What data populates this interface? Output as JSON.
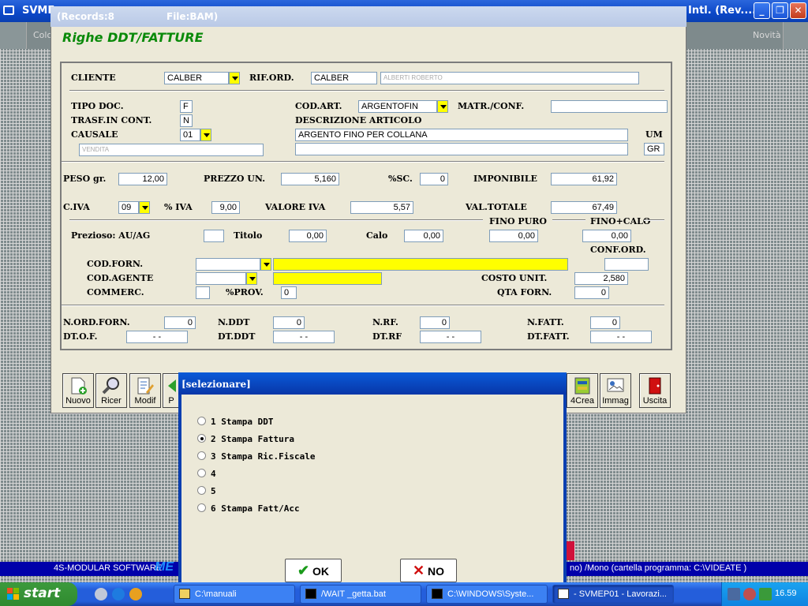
{
  "app": {
    "title": "SVME",
    "title_right": "Intl. (Rev....",
    "toolbar_left": "Colo",
    "toolbar_right": "Novità"
  },
  "window": {
    "records": "(Records:8",
    "file": "File:BAM)",
    "form_title": "Righe DDT/FATTURE"
  },
  "form": {
    "cliente_label": "CLIENTE",
    "cliente": "CALBER",
    "rif_ord_label": "RIF.ORD.",
    "rif_ord": "CALBER",
    "cliente_name": "ALBERTI ROBERTO",
    "tipo_doc_label": "TIPO DOC.",
    "tipo_doc": "F",
    "trasf_label": "TRASF.IN CONT.",
    "trasf": "N",
    "causale_label": "CAUSALE",
    "causale": "01",
    "causale_desc": "VENDITA",
    "cod_art_label": "COD.ART.",
    "cod_art": "ARGENTOFIN",
    "matr_label": "MATR./CONF.",
    "matr": "",
    "descr_label": "DESCRIZIONE ARTICOLO",
    "descr": "ARGENTO FINO PER COLLANA",
    "descr2": "",
    "um_label": "UM",
    "um": "GR",
    "peso_label": "PESO gr.",
    "peso": "12,00",
    "prezzo_label": "PREZZO UN.",
    "prezzo": "5,160",
    "sc_label": "%SC.",
    "sc": "0",
    "imponibile_label": "IMPONIBILE",
    "imponibile": "61,92",
    "civa_label": "C.IVA",
    "civa": "09",
    "piva_label": "% IVA",
    "piva": "9,00",
    "valore_iva_label": "VALORE IVA",
    "valore_iva": "5,57",
    "val_totale_label": "VAL.TOTALE",
    "val_totale": "67,49",
    "fino_puro_label": "FINO PURO",
    "fino_calo_label": "FINO+CALO",
    "prezioso_label": "Prezioso: AU/AG",
    "prezioso": "",
    "titolo_label": "Titolo",
    "titolo": "0,00",
    "calo_label": "Calo",
    "calo": "0,00",
    "fino_puro": "0,00",
    "fino_calo": "0,00",
    "conf_ord_label": "CONF.ORD.",
    "cod_forn_label": "COD.FORN.",
    "cod_forn": "",
    "conf_ord": "",
    "cod_agente_label": "COD.AGENTE",
    "cod_agente": "",
    "costo_unit_label": "COSTO UNIT.",
    "costo_unit": "2,580",
    "commerc_label": "COMMERC.",
    "commerc": "",
    "prov_label": "%PROV.",
    "prov": "0",
    "qta_forn_label": "QTA FORN.",
    "qta_forn": "0",
    "n_ord_forn_label": "N.ORD.FORN.",
    "n_ord_forn": "0",
    "n_ddt_label": "N.DDT",
    "n_ddt": "0",
    "n_rf_label": "N.RF.",
    "n_rf": "0",
    "n_fatt_label": "N.FATT.",
    "n_fatt": "0",
    "dt_of_label": "DT.O.F.",
    "dt_of": "-   -",
    "dt_ddt_label": "DT.DDT",
    "dt_ddt": "-   -",
    "dt_rf_label": "DT.RF",
    "dt_rf": "-   -",
    "dt_fatt_label": "DT.FATT.",
    "dt_fatt": "-   -"
  },
  "toolbar": {
    "nuovo": "Nuovo",
    "ricer": "Ricer",
    "modif": "Modif",
    "p": "P",
    "crea": "4Crea",
    "immag": "Immag",
    "uscita": "Uscita"
  },
  "dialog": {
    "title": "[selezionare]",
    "options": [
      {
        "label": "1 Stampa DDT",
        "selected": false
      },
      {
        "label": "2 Stampa Fattura",
        "selected": true
      },
      {
        "label": "3 Stampa Ric.Fiscale",
        "selected": false
      },
      {
        "label": "4",
        "selected": false
      },
      {
        "label": "5",
        "selected": false
      },
      {
        "label": "6 Stampa Fatt/Acc",
        "selected": false
      }
    ],
    "ok": "OK",
    "no": "NO"
  },
  "status": {
    "left": "4S-MODULAR SOFTWARE",
    "me": "ME",
    "right": "no)  /Mono  (cartella programma: C:\\VIDEATE )"
  },
  "taskbar": {
    "start": "start",
    "tasks": [
      "C:\\manuali",
      "/WAIT _getta.bat",
      "C:\\WINDOWS\\Syste...",
      "- SVMEP01 - Lavorazi..."
    ],
    "clock": "16.59"
  },
  "colors": {
    "accent_green": "#0a8a0a",
    "highlight_yellow": "#ffff00",
    "status_blue": "#0000aa"
  }
}
